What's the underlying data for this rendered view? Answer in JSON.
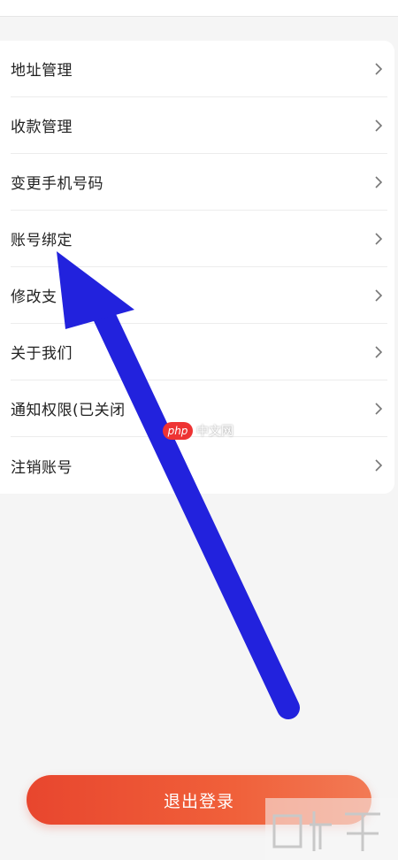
{
  "menu": {
    "items": [
      {
        "label": "地址管理",
        "icon": "chevron-right-icon"
      },
      {
        "label": "收款管理",
        "icon": "chevron-right-icon"
      },
      {
        "label": "变更手机号码",
        "icon": "chevron-right-icon"
      },
      {
        "label": "账号绑定",
        "icon": "chevron-right-icon"
      },
      {
        "label": "修改支",
        "icon": "chevron-right-icon"
      },
      {
        "label": "关于我们",
        "icon": "chevron-right-icon"
      },
      {
        "label": "通知权限(已关闭",
        "icon": "chevron-right-icon"
      },
      {
        "label": "注销账号",
        "icon": "chevron-right-icon"
      }
    ]
  },
  "watermark": {
    "badge": "php",
    "text": "中文网"
  },
  "logout": {
    "label": "退出登录"
  },
  "colors": {
    "accent": "#e8462e",
    "arrow": "#2222dd",
    "text": "#222222",
    "chevron": "#777777"
  }
}
